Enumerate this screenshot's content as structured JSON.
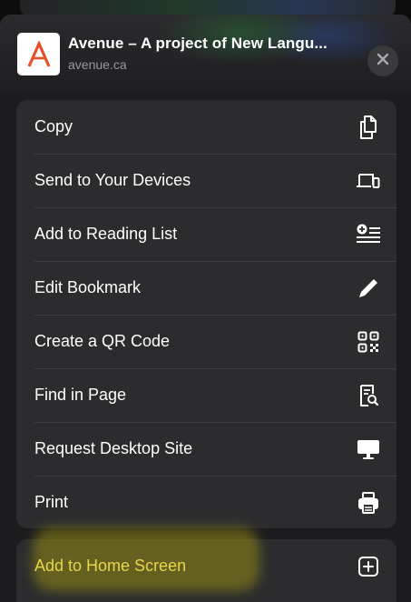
{
  "header": {
    "title": "Avenue – A project of New Langu...",
    "url": "avenue.ca",
    "app_icon": "avenue-logo-icon",
    "close_icon": "close-icon"
  },
  "menu": {
    "items": [
      {
        "label": "Copy",
        "icon": "copy-icon"
      },
      {
        "label": "Send to Your Devices",
        "icon": "devices-icon"
      },
      {
        "label": "Add to Reading List",
        "icon": "reading-list-icon"
      },
      {
        "label": "Edit Bookmark",
        "icon": "pencil-icon"
      },
      {
        "label": "Create a QR Code",
        "icon": "qr-code-icon"
      },
      {
        "label": "Find in Page",
        "icon": "find-in-page-icon"
      },
      {
        "label": "Request Desktop Site",
        "icon": "desktop-icon"
      },
      {
        "label": "Print",
        "icon": "printer-icon"
      }
    ]
  },
  "secondary": {
    "add_home_label": "Add to Home Screen",
    "icon": "plus-square-icon",
    "highlight_color": "#e6d64a"
  },
  "colors": {
    "sheet": "#1c1c1e",
    "group": "#2c2c2e",
    "text": "#ffffff",
    "subtext": "#98989d"
  }
}
